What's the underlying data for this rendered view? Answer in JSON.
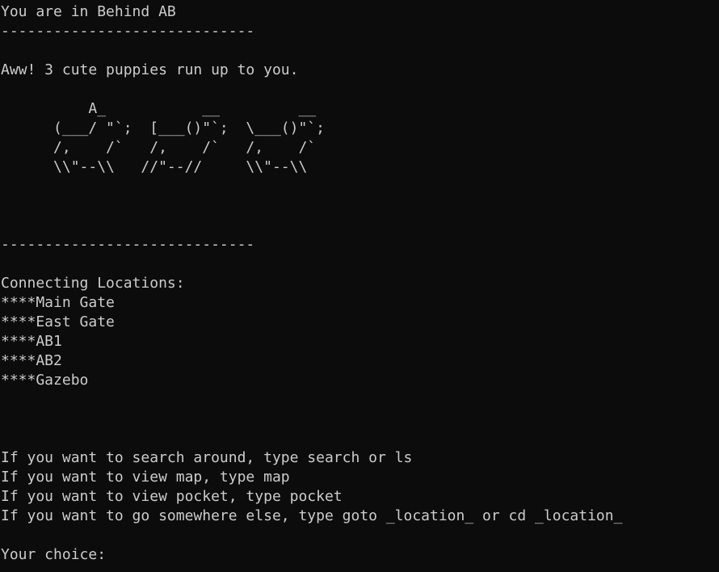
{
  "terminal": {
    "location_line": "You are in Behind AB",
    "divider": "-----------------------------",
    "message": "Aww! 3 cute puppies run up to you.",
    "art": [
      "          A_           __         __",
      "      (___/ \"`;  [___()\"`;  \\___()\"`;",
      "      /,    /`   /,    /`   /,    /`",
      "      \\\\\"--\\\\   //\"--//     \\\\\"--\\\\"
    ],
    "connecting_heading": "Connecting Locations:",
    "locations": [
      "****Main Gate",
      "****East Gate",
      "****AB1",
      "****AB2",
      "****Gazebo"
    ],
    "instructions": [
      "If you want to search around, type search or ls",
      "If you want to view map, type map",
      "If you want to view pocket, type pocket",
      "If you want to go somewhere else, type goto _location_ or cd _location_"
    ],
    "prompt": "Your choice:"
  },
  "colors": {
    "background": "#0c0c0c",
    "foreground": "#cccccc"
  }
}
